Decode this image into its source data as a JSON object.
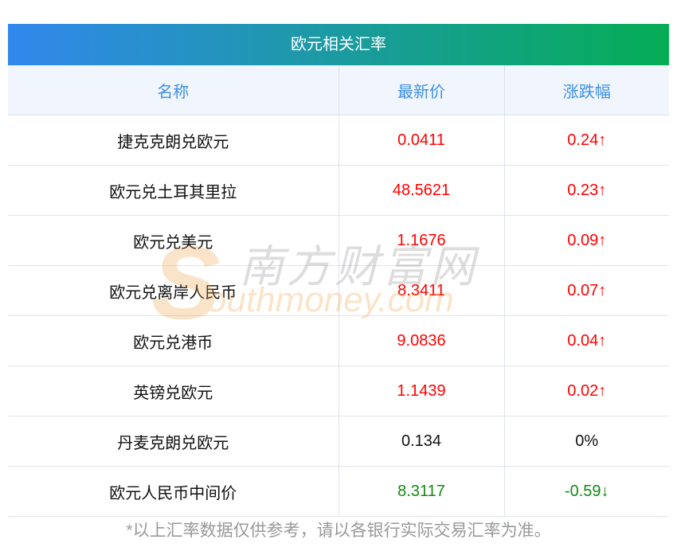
{
  "title": "欧元相关汇率",
  "headers": [
    "名称",
    "最新价",
    "涨跌幅"
  ],
  "rows": [
    {
      "name": "捷克克朗兑欧元",
      "price": "0.0411",
      "change": "0.24↑",
      "trend": "up"
    },
    {
      "name": "欧元兑土耳其里拉",
      "price": "48.5621",
      "change": "0.23↑",
      "trend": "up"
    },
    {
      "name": "欧元兑美元",
      "price": "1.1676",
      "change": "0.09↑",
      "trend": "up"
    },
    {
      "name": "欧元兑离岸人民币",
      "price": "8.3411",
      "change": "0.07↑",
      "trend": "up"
    },
    {
      "name": "欧元兑港币",
      "price": "9.0836",
      "change": "0.04↑",
      "trend": "up"
    },
    {
      "name": "英镑兑欧元",
      "price": "1.1439",
      "change": "0.02↑",
      "trend": "up"
    },
    {
      "name": "丹麦克朗兑欧元",
      "price": "0.134",
      "change": "0%",
      "trend": "flat"
    },
    {
      "name": "欧元人民币中间价",
      "price": "8.3117",
      "change": "-0.59↓",
      "trend": "down"
    }
  ],
  "watermark": {
    "cn": "南方财富网",
    "en": "outhmoney.com",
    "s": "S"
  },
  "note": "*以上汇率数据仅供参考，请以各银行实际交易汇率为准。",
  "colors": {
    "up": "#ff0000",
    "down": "#108a10",
    "header": "#3d8fe6"
  }
}
